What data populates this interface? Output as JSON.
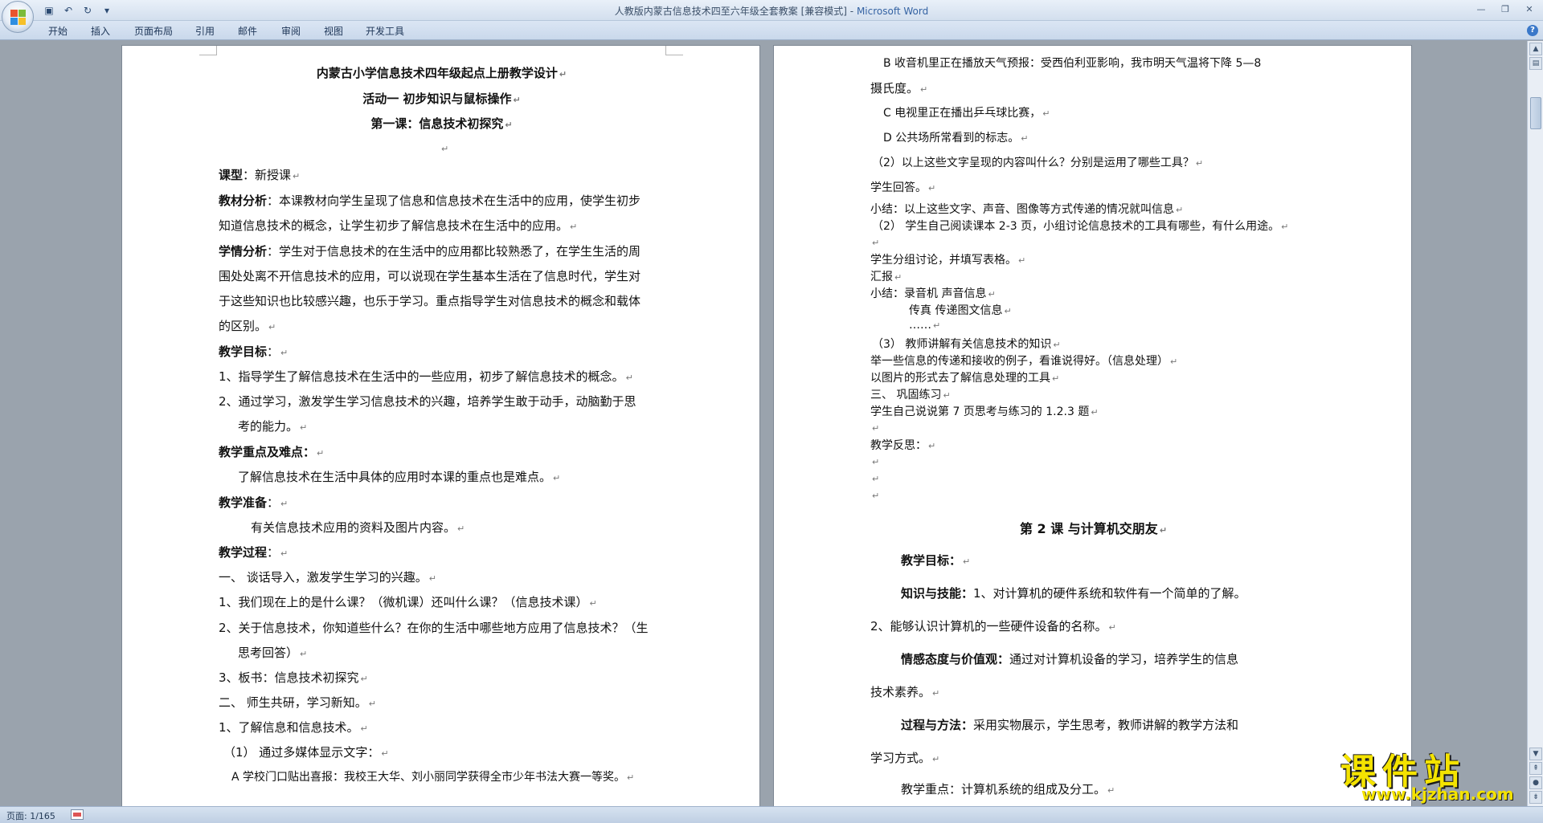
{
  "window": {
    "title_doc": "人教版内蒙古信息技术四至六年级全套教案 [兼容模式]",
    "title_sep": " - ",
    "title_app": "Microsoft Word"
  },
  "ribbon": {
    "tabs": [
      "开始",
      "插入",
      "页面布局",
      "引用",
      "邮件",
      "审阅",
      "视图",
      "开发工具"
    ]
  },
  "status": {
    "page": "页面: 1/165"
  },
  "left_page": {
    "title1": "内蒙古小学信息技术四年级起点上册教学设计",
    "title2": "活动一   初步知识与鼠标操作",
    "title3": "第一课：信息技术初探究",
    "p_lesson_type_label": "课型",
    "p_lesson_type_value": "：新授课",
    "p_material_label": "教材分析",
    "p_material_1": "：本课教材向学生呈现了信息和信息技术在生活中的应用，使学生初步",
    "p_material_2": "知道信息技术的概念，让学生初步了解信息技术在生活中的应用。",
    "p_student_label": "学情分析",
    "p_student_1": "：学生对于信息技术的在生活中的应用都比较熟悉了，在学生生活的周",
    "p_student_2": "围处处离不开信息技术的应用，可以说现在学生基本生活在了信息时代，学生对",
    "p_student_3": "于这些知识也比较感兴趣，也乐于学习。重点指导学生对信息技术的概念和载体",
    "p_student_4": "的区别。",
    "goal_label": "教学目标",
    "goal_colon": "：",
    "goal_1": "1、指导学生了解信息技术在生活中的一些应用，初步了解信息技术的概念。",
    "goal_2a": "2、通过学习，激发学生学习信息技术的兴趣，培养学生敢于动手，动脑勤于思",
    "goal_2b": "考的能力。",
    "key_label": "教学重点及难点：",
    "key_text": "了解信息技术在生活中具体的应用时本课的重点也是难点。",
    "prep_label": "教学准备",
    "prep_colon": "：",
    "prep_text": "有关信息技术应用的资料及图片内容。",
    "process_label": "教学过程",
    "process_colon": "：",
    "step1": "一、    谈话导入，激发学生学习的兴趣。",
    "q1": "1、我们现在上的是什么课？（微机课）还叫什么课？（信息技术课）",
    "q2a": "2、关于信息技术，你知道些什么？在你的生活中哪些地方应用了信息技术？（生",
    "q2b": "思考回答）",
    "q3": "3、板书：信息技术初探究",
    "step2": "二、    师生共研，学习新知。",
    "learn1": "1、了解信息和信息技术。",
    "learn1_1": "（1）  通过多媒体显示文字：",
    "learn_a": "A 学校门口贴出喜报：我校王大华、刘小丽同学获得全市少年书法大赛一等奖。"
  },
  "right_page": {
    "b1": "B 收音机里正在播放天气预报：受西伯利亚影响，我市明天气温将下降  5—8",
    "b2": "摄氏度。",
    "c": "C 电视里正在播出乒乓球比赛，",
    "d": "D 公共场所常看到的标志。",
    "q2": "（2）以上这些文字呈现的内容叫什么？分别是运用了哪些工具？",
    "ans": "学生回答。",
    "summary1": "小结：以上这些文字、声音、图像等方式传递的情况就叫信息",
    "read": "（2）  学生自己阅读课本 2-3 页，小组讨论信息技术的工具有哪些，有什么用途。",
    "group": "学生分组讨论，并填写表格。",
    "report": "汇报",
    "summary2_a": "小结：录音机    声音信息",
    "summary2_b": "传真       传递图文信息",
    "ellipsis": "……",
    "t3": "（3） 教师讲解有关信息技术的知识",
    "example": "举一些信息的传递和接收的例子，看谁说得好。（信息处理）",
    "pic": "以图片的形式去了解信息处理的工具",
    "step3": "三、    巩固练习",
    "practice": "学生自己说说第 7 页思考与练习的 1.2.3 题",
    "reflect": "教学反思：",
    "lesson2": "第 2 课  与计算机交朋友",
    "goal_label": "教学目标：",
    "skill_label": "知识与技能：",
    "skill_text": "1、对计算机的硬件系统和软件有一个简单的了解。",
    "skill_2": "2、能够认识计算机的一些硬件设备的名称。",
    "emotion_label": "情感态度与价值观：",
    "emotion_text": "通过对计算机设备的学习，培养学生的信息",
    "emotion_2": "技术素养。",
    "method_label": "过程与方法：",
    "method_text": "采用实物展示，学生思考，教师讲解的教学方法和",
    "method_2": "学习方式。",
    "key": "教学重点：计算机系统的组成及分工。"
  },
  "paragraph_mark": "↵",
  "watermark": {
    "main": "课件站",
    "sub": "www.kjzhan.com"
  },
  "colors": {
    "title_app": "#3563a3",
    "watermark": "#f4e300",
    "doc_bg": "#9aa3ad"
  }
}
